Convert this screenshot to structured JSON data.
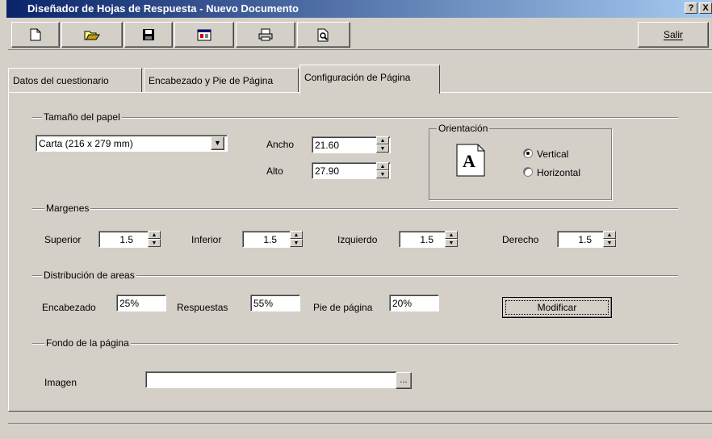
{
  "window": {
    "title": "Diseñador de Hojas de Respuesta - Nuevo Documento",
    "help_button": "?",
    "close_button": "X"
  },
  "toolbar": {
    "items": [
      {
        "icon": "new-document-icon"
      },
      {
        "icon": "open-folder-icon"
      },
      {
        "icon": "save-disk-icon"
      },
      {
        "icon": "properties-icon"
      },
      {
        "icon": "print-icon"
      },
      {
        "icon": "print-preview-icon"
      }
    ],
    "exit_label": "Salir"
  },
  "tabs": [
    {
      "label": "Datos del cuestionario",
      "active": false
    },
    {
      "label": "Encabezado y Pie de Página",
      "active": false
    },
    {
      "label": "Configuración de Página",
      "active": true
    }
  ],
  "paper": {
    "group_title": "Tamaño del papel",
    "selected": "Carta  (216 x 279 mm)",
    "width_label": "Ancho",
    "width_value": "21.60",
    "height_label": "Alto",
    "height_value": "27.90"
  },
  "orientation": {
    "group_title": "Orientación",
    "glyph": "A",
    "vertical_label": "Vertical",
    "horizontal_label": "Horizontal",
    "selected": "Vertical"
  },
  "margins": {
    "group_title": "Margenes",
    "top_label": "Superior",
    "top_value": "1.5",
    "bottom_label": "Inferior",
    "bottom_value": "1.5",
    "left_label": "Izquierdo",
    "left_value": "1.5",
    "right_label": "Derecho",
    "right_value": "1.5"
  },
  "areas": {
    "group_title": "Distribución de areas",
    "header_label": "Encabezado",
    "header_value": "25%",
    "answers_label": "Respuestas",
    "answers_value": "55%",
    "footer_label": "Pie de página",
    "footer_value": "20%",
    "modify_label": "Modificar"
  },
  "background": {
    "group_title": "Fondo de la página",
    "image_label": "Imagen",
    "image_value": "",
    "browse_label": "..."
  }
}
